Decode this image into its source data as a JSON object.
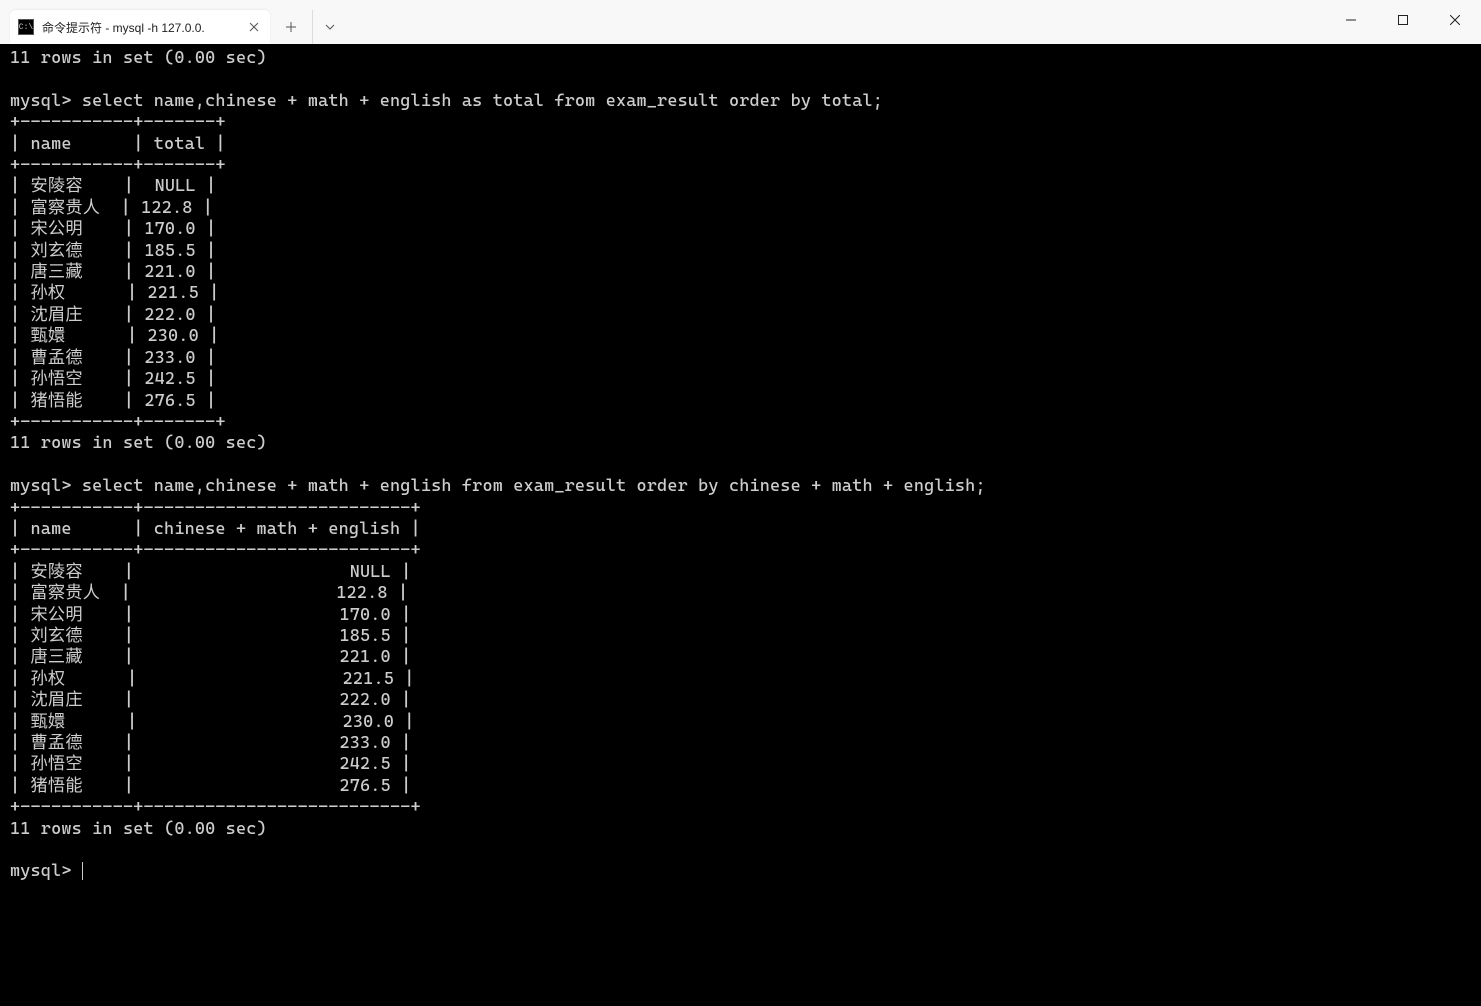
{
  "window": {
    "tab_title": "命令提示符 - mysql  -h 127.0.0.",
    "tab_icon_text": "C:\\"
  },
  "terminal": {
    "rows_in_set_1": "11 rows in set (0.00 sec)",
    "prompt1": "mysql> select name,chinese + math + english as total from exam_result order by total;",
    "table1_sep": "+-----------+-------+",
    "table1_header": "| name      | total |",
    "table1_rows": [
      "| 安陵容    |  NULL |",
      "| 富察贵人  | 122.8 |",
      "| 宋公明    | 170.0 |",
      "| 刘玄德    | 185.5 |",
      "| 唐三藏    | 221.0 |",
      "| 孙权      | 221.5 |",
      "| 沈眉庄    | 222.0 |",
      "| 甄嬛      | 230.0 |",
      "| 曹孟德    | 233.0 |",
      "| 孙悟空    | 242.5 |",
      "| 猪悟能    | 276.5 |"
    ],
    "rows_in_set_2": "11 rows in set (0.00 sec)",
    "prompt2": "mysql> select name,chinese + math + english from exam_result order by chinese + math + english;",
    "table2_sep": "+-----------+--------------------------+",
    "table2_header": "| name      | chinese + math + english |",
    "table2_rows": [
      "| 安陵容    |                     NULL |",
      "| 富察贵人  |                    122.8 |",
      "| 宋公明    |                    170.0 |",
      "| 刘玄德    |                    185.5 |",
      "| 唐三藏    |                    221.0 |",
      "| 孙权      |                    221.5 |",
      "| 沈眉庄    |                    222.0 |",
      "| 甄嬛      |                    230.0 |",
      "| 曹孟德    |                    233.0 |",
      "| 孙悟空    |                    242.5 |",
      "| 猪悟能    |                    276.5 |"
    ],
    "rows_in_set_3": "11 rows in set (0.00 sec)",
    "prompt3": "mysql> "
  }
}
